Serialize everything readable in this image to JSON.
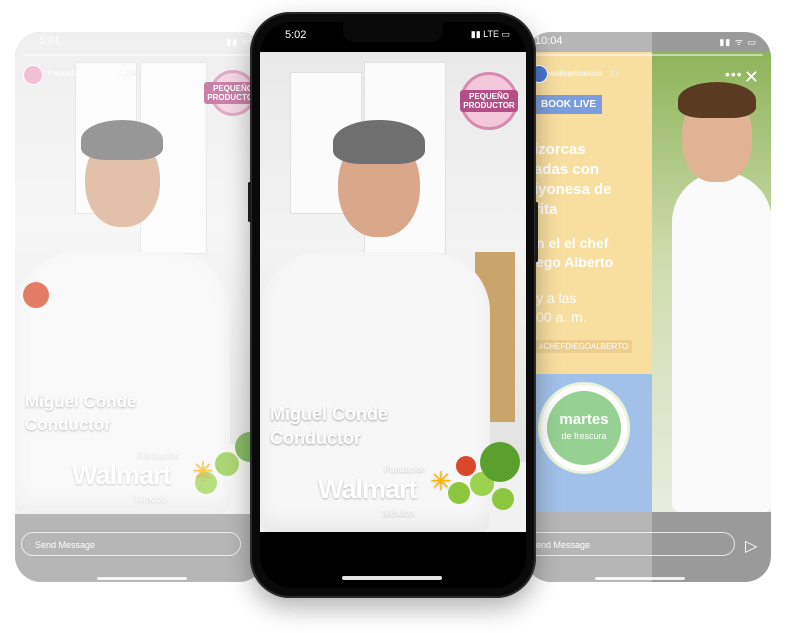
{
  "left_story": {
    "time": "5:01",
    "status_icons": "▮▮ ᯤ",
    "username": "PequeñoProductor",
    "age": "20w",
    "more": "•••",
    "badge": "PEQUEÑO PRODUCTOR",
    "lower_third": {
      "name": "Miguel Conde",
      "role": "Conductor"
    },
    "walmart": {
      "fundacion": "Fundación",
      "word": "Walmart",
      "mexico": "México"
    },
    "send_message": "Send Message"
  },
  "center_story": {
    "time": "5:02",
    "status_icons": "▮▮ LTE ▭",
    "badge": "PEQUEÑO PRODUCTOR",
    "lower_third": {
      "name": "Miguel Conde",
      "role": "Conductor"
    },
    "walmart": {
      "fundacion": "Fundación",
      "word": "Walmart",
      "mexico": "México"
    }
  },
  "right_story": {
    "time": "10:04",
    "status_icons": "▮▮ ᯤ ▭",
    "username": "walmartmexico",
    "age": "1h",
    "more": "•••",
    "close": "✕",
    "book_live": "BOOK LIVE",
    "recipe_lines": [
      "izorcas",
      "adas con",
      "iyonesa de",
      "rita"
    ],
    "chef_line1": "n el el chef",
    "chef_line2": "ego Alberto",
    "time_line1": "y a las",
    "time_line2": "00 a. m.",
    "hashtag": "#CHEFDIEGOALBERTO",
    "martes_logo": {
      "line1": "martes",
      "line2": "de frescura"
    },
    "send_message": "Send Message",
    "send_icon": "▷"
  },
  "colors": {
    "accent_pink": "#b34f86",
    "walmart_yellow": "#f7b500",
    "promo_yellow": "#f6d27a",
    "promo_blue": "#4a78d0"
  }
}
